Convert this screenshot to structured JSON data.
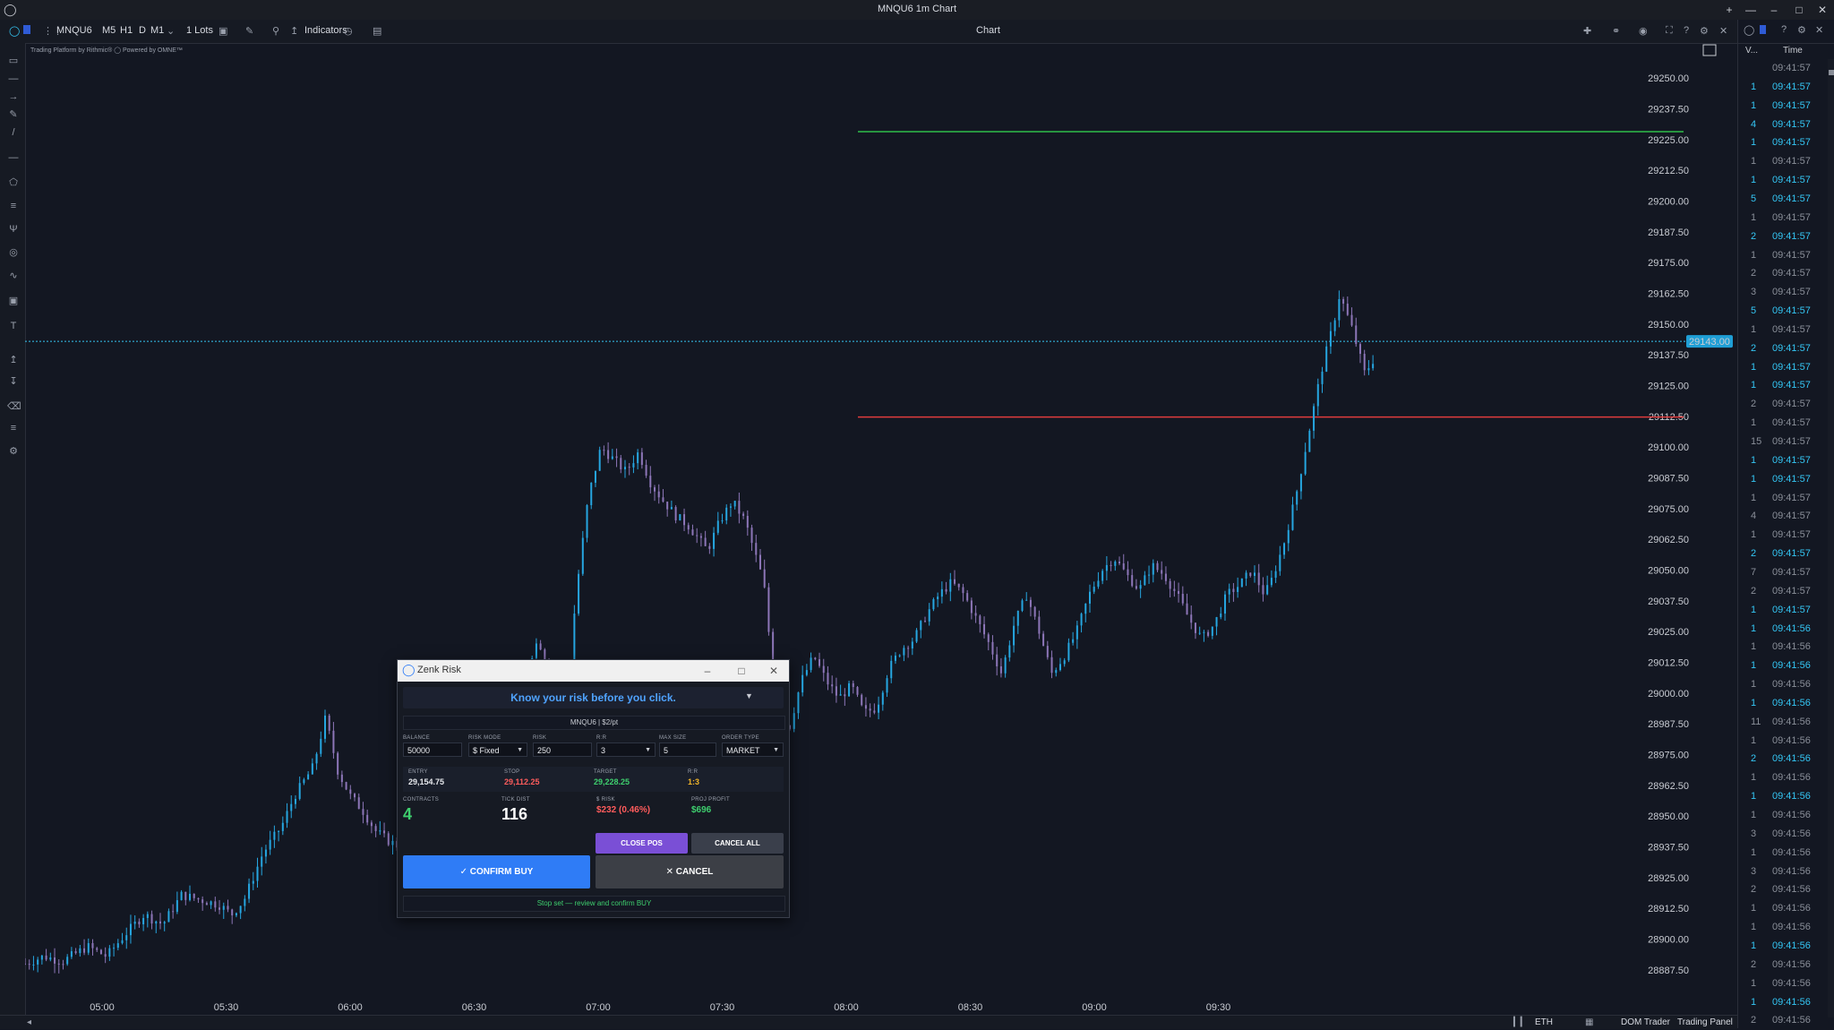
{
  "window": {
    "title": "MNQU6 1m Chart"
  },
  "toolbar": {
    "symbol": "MNQU6",
    "timeframes": [
      "M5",
      "H1",
      "D",
      "M1"
    ],
    "lots": "1 Lots",
    "indicators": "Indicators",
    "chart_tab": "Chart"
  },
  "branding": "Trading Platform by Rithmic®  ◯ Powered by OMNE™",
  "chart_data": {
    "type": "candlestick",
    "symbol": "MNQU6",
    "timeframe": "1m",
    "y_ticks": [
      "29250.00",
      "29237.50",
      "29225.00",
      "29212.50",
      "29200.00",
      "29187.50",
      "29175.00",
      "29162.50",
      "29150.00",
      "29137.50",
      "29125.00",
      "29112.50",
      "29100.00",
      "29087.50",
      "29075.00",
      "29062.50",
      "29050.00",
      "29037.50",
      "29025.00",
      "29012.50",
      "29000.00",
      "28987.50",
      "28975.00",
      "28962.50",
      "28950.00",
      "28937.50",
      "28925.00",
      "28912.50",
      "28900.00",
      "28887.50"
    ],
    "ylim": [
      28882,
      29257
    ],
    "x_ticks": [
      "05:00",
      "05:30",
      "06:00",
      "06:30",
      "07:00",
      "07:30",
      "08:00",
      "08:30",
      "09:00",
      "09:30"
    ],
    "current_price": "29143.00",
    "lines": [
      {
        "kind": "target",
        "price": 29228.25,
        "color": "#2ebd4b"
      },
      {
        "kind": "stop",
        "price": 29112.25,
        "color": "#e03c3c"
      }
    ],
    "path": [
      [
        0,
        28890
      ],
      [
        6,
        28893
      ],
      [
        12,
        28891
      ],
      [
        20,
        28897
      ],
      [
        26,
        28893
      ],
      [
        32,
        28902
      ],
      [
        38,
        28910
      ],
      [
        44,
        28906
      ],
      [
        50,
        28918
      ],
      [
        56,
        28916
      ],
      [
        62,
        28914
      ],
      [
        66,
        28910
      ],
      [
        70,
        28916
      ],
      [
        76,
        28935
      ],
      [
        82,
        28946
      ],
      [
        86,
        28958
      ],
      [
        92,
        28970
      ],
      [
        96,
        28990
      ],
      [
        100,
        28968
      ],
      [
        104,
        28958
      ],
      [
        108,
        28952
      ],
      [
        112,
        28944
      ],
      [
        116,
        28940
      ],
      [
        122,
        28936
      ],
      [
        126,
        28930
      ],
      [
        130,
        28934
      ],
      [
        136,
        28936
      ],
      [
        142,
        28939
      ],
      [
        148,
        28936
      ],
      [
        152,
        28960
      ],
      [
        156,
        28995
      ],
      [
        160,
        29010
      ],
      [
        164,
        29022
      ],
      [
        168,
        29007
      ],
      [
        172,
        28985
      ],
      [
        174,
        29010
      ],
      [
        176,
        29040
      ],
      [
        180,
        29080
      ],
      [
        184,
        29100
      ],
      [
        188,
        29095
      ],
      [
        192,
        29090
      ],
      [
        196,
        29098
      ],
      [
        200,
        29085
      ],
      [
        204,
        29078
      ],
      [
        208,
        29072
      ],
      [
        212,
        29068
      ],
      [
        218,
        29058
      ],
      [
        222,
        29070
      ],
      [
        226,
        29078
      ],
      [
        230,
        29070
      ],
      [
        236,
        29045
      ],
      [
        240,
        28995
      ],
      [
        244,
        28985
      ],
      [
        248,
        29005
      ],
      [
        252,
        29015
      ],
      [
        256,
        29005
      ],
      [
        260,
        28998
      ],
      [
        264,
        29003
      ],
      [
        268,
        28992
      ],
      [
        272,
        28994
      ],
      [
        276,
        29010
      ],
      [
        280,
        29018
      ],
      [
        284,
        29022
      ],
      [
        288,
        29032
      ],
      [
        292,
        29040
      ],
      [
        296,
        29045
      ],
      [
        300,
        29040
      ],
      [
        304,
        29030
      ],
      [
        308,
        29020
      ],
      [
        312,
        29008
      ],
      [
        316,
        29028
      ],
      [
        320,
        29040
      ],
      [
        324,
        29025
      ],
      [
        328,
        29008
      ],
      [
        332,
        29015
      ],
      [
        336,
        29025
      ],
      [
        340,
        29040
      ],
      [
        344,
        29050
      ],
      [
        348,
        29055
      ],
      [
        352,
        29048
      ],
      [
        356,
        29042
      ],
      [
        360,
        29052
      ],
      [
        364,
        29048
      ],
      [
        368,
        29040
      ],
      [
        372,
        29030
      ],
      [
        376,
        29022
      ],
      [
        380,
        29028
      ],
      [
        384,
        29040
      ],
      [
        388,
        29044
      ],
      [
        392,
        29050
      ],
      [
        396,
        29040
      ],
      [
        398,
        29045
      ],
      [
        402,
        29060
      ],
      [
        406,
        29080
      ],
      [
        410,
        29105
      ],
      [
        414,
        29130
      ],
      [
        418,
        29150
      ],
      [
        420,
        29162
      ],
      [
        424,
        29148
      ],
      [
        428,
        29130
      ],
      [
        432,
        29138
      ]
    ]
  },
  "right_panel": {
    "col_vol": "V...",
    "col_time": "Time",
    "rows": [
      {
        "v": "",
        "t": "09:41:57",
        "hl": false
      },
      {
        "v": "1",
        "t": "09:41:57",
        "hl": true
      },
      {
        "v": "1",
        "t": "09:41:57",
        "hl": true
      },
      {
        "v": "4",
        "t": "09:41:57",
        "hl": true
      },
      {
        "v": "1",
        "t": "09:41:57",
        "hl": true
      },
      {
        "v": "1",
        "t": "09:41:57",
        "hl": false
      },
      {
        "v": "1",
        "t": "09:41:57",
        "hl": true
      },
      {
        "v": "5",
        "t": "09:41:57",
        "hl": true
      },
      {
        "v": "1",
        "t": "09:41:57",
        "hl": false
      },
      {
        "v": "2",
        "t": "09:41:57",
        "hl": true
      },
      {
        "v": "1",
        "t": "09:41:57",
        "hl": false
      },
      {
        "v": "2",
        "t": "09:41:57",
        "hl": false
      },
      {
        "v": "3",
        "t": "09:41:57",
        "hl": false
      },
      {
        "v": "5",
        "t": "09:41:57",
        "hl": true
      },
      {
        "v": "1",
        "t": "09:41:57",
        "hl": false
      },
      {
        "v": "2",
        "t": "09:41:57",
        "hl": true
      },
      {
        "v": "1",
        "t": "09:41:57",
        "hl": true
      },
      {
        "v": "1",
        "t": "09:41:57",
        "hl": true
      },
      {
        "v": "2",
        "t": "09:41:57",
        "hl": false
      },
      {
        "v": "1",
        "t": "09:41:57",
        "hl": false
      },
      {
        "v": "15",
        "t": "09:41:57",
        "hl": false
      },
      {
        "v": "1",
        "t": "09:41:57",
        "hl": true
      },
      {
        "v": "1",
        "t": "09:41:57",
        "hl": true
      },
      {
        "v": "1",
        "t": "09:41:57",
        "hl": false
      },
      {
        "v": "4",
        "t": "09:41:57",
        "hl": false
      },
      {
        "v": "1",
        "t": "09:41:57",
        "hl": false
      },
      {
        "v": "2",
        "t": "09:41:57",
        "hl": true
      },
      {
        "v": "7",
        "t": "09:41:57",
        "hl": false
      },
      {
        "v": "2",
        "t": "09:41:57",
        "hl": false
      },
      {
        "v": "1",
        "t": "09:41:57",
        "hl": true
      },
      {
        "v": "1",
        "t": "09:41:56",
        "hl": true
      },
      {
        "v": "1",
        "t": "09:41:56",
        "hl": false
      },
      {
        "v": "1",
        "t": "09:41:56",
        "hl": true
      },
      {
        "v": "1",
        "t": "09:41:56",
        "hl": false
      },
      {
        "v": "1",
        "t": "09:41:56",
        "hl": true
      },
      {
        "v": "11",
        "t": "09:41:56",
        "hl": false
      },
      {
        "v": "1",
        "t": "09:41:56",
        "hl": false
      },
      {
        "v": "2",
        "t": "09:41:56",
        "hl": true
      },
      {
        "v": "1",
        "t": "09:41:56",
        "hl": false
      },
      {
        "v": "1",
        "t": "09:41:56",
        "hl": true
      },
      {
        "v": "1",
        "t": "09:41:56",
        "hl": false
      },
      {
        "v": "3",
        "t": "09:41:56",
        "hl": false
      },
      {
        "v": "1",
        "t": "09:41:56",
        "hl": false
      },
      {
        "v": "3",
        "t": "09:41:56",
        "hl": false
      },
      {
        "v": "2",
        "t": "09:41:56",
        "hl": false
      },
      {
        "v": "1",
        "t": "09:41:56",
        "hl": false
      },
      {
        "v": "1",
        "t": "09:41:56",
        "hl": false
      },
      {
        "v": "1",
        "t": "09:41:56",
        "hl": true
      },
      {
        "v": "2",
        "t": "09:41:56",
        "hl": false
      },
      {
        "v": "1",
        "t": "09:41:56",
        "hl": false
      },
      {
        "v": "1",
        "t": "09:41:56",
        "hl": true
      },
      {
        "v": "2",
        "t": "09:41:56",
        "hl": false
      }
    ]
  },
  "status_bar": {
    "session": "ETH",
    "dom_trader": "DOM Trader",
    "trading_panel": "Trading Panel"
  },
  "dialog": {
    "title": "Zenk Risk",
    "headline": "Know your risk before you click.",
    "symbol_line": "MNQU6  |  $2/pt",
    "fields": {
      "balance": {
        "label": "BALANCE",
        "value": "50000"
      },
      "risk_mode": {
        "label": "RISK MODE",
        "value": "$ Fixed"
      },
      "risk": {
        "label": "RISK",
        "value": "250"
      },
      "rr": {
        "label": "R:R",
        "value": "3"
      },
      "max_size": {
        "label": "MAX SIZE",
        "value": "5"
      },
      "order_type": {
        "label": "ORDER TYPE",
        "value": "MARKET"
      }
    },
    "prices": {
      "entry_label": "ENTRY",
      "entry": "29,154.75",
      "stop_label": "STOP",
      "stop": "29,112.25",
      "target_label": "TARGET",
      "target": "29,228.25",
      "rr_label": "R:R",
      "rr": "1:3"
    },
    "stats": {
      "contracts_label": "CONTRACTS",
      "contracts": "4",
      "tick_label": "TICK DIST",
      "tick": "116",
      "risk_label": "$ RISK",
      "risk": "$232 (0.46%)",
      "profit_label": "PROJ PROFIT",
      "profit": "$696"
    },
    "buttons": {
      "close_pos": "CLOSE POS",
      "cancel_all": "CANCEL ALL",
      "confirm": "✓ CONFIRM BUY",
      "cancel": "✕ CANCEL"
    },
    "status": "Stop set — review and confirm BUY",
    "colors": {
      "blue": "#2f7cf6",
      "purple": "#7a4fd6",
      "green": "#3ecf6e",
      "red": "#ff5c5c",
      "amber": "#f0b429"
    }
  }
}
